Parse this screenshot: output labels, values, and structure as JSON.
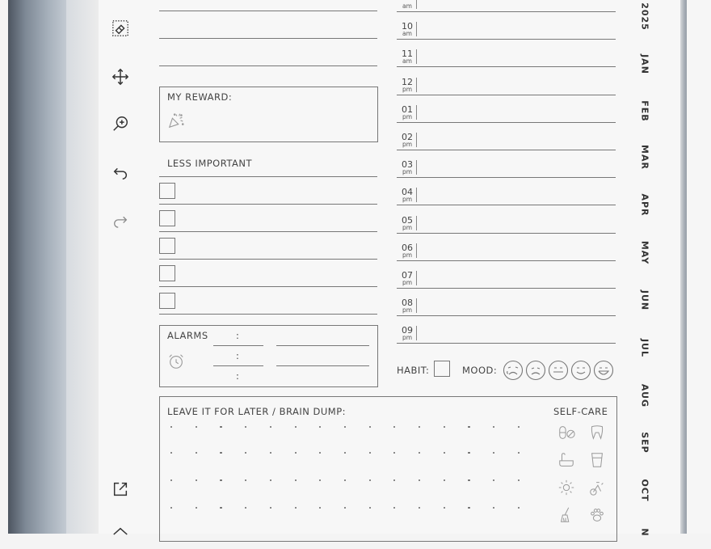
{
  "toolbar": {
    "icons": [
      "eraser-icon",
      "move-icon",
      "zoom-icon",
      "undo-icon",
      "redo-icon",
      "share-icon",
      "home-icon"
    ]
  },
  "planner": {
    "reward_label": "MY REWARD:",
    "less_important_label": "LESS IMPORTANT",
    "alarms_label": "ALARMS",
    "alarm_colon": ":",
    "brain_dump_label": "LEAVE IT FOR LATER / BRAIN DUMP:",
    "self_care_label": "SELF-CARE",
    "habit_label": "HABIT:",
    "mood_label": "MOOD:",
    "hours": [
      {
        "num": "",
        "ampm": "am"
      },
      {
        "num": "10",
        "ampm": "am"
      },
      {
        "num": "11",
        "ampm": "am"
      },
      {
        "num": "12",
        "ampm": "pm"
      },
      {
        "num": "01",
        "ampm": "pm"
      },
      {
        "num": "02",
        "ampm": "pm"
      },
      {
        "num": "03",
        "ampm": "pm"
      },
      {
        "num": "04",
        "ampm": "pm"
      },
      {
        "num": "05",
        "ampm": "pm"
      },
      {
        "num": "06",
        "ampm": "pm"
      },
      {
        "num": "07",
        "ampm": "pm"
      },
      {
        "num": "08",
        "ampm": "pm"
      },
      {
        "num": "09",
        "ampm": "pm"
      }
    ]
  },
  "months_tabs": {
    "year": "2025",
    "months": [
      "JAN",
      "FEB",
      "MAR",
      "APR",
      "MAY",
      "JUN",
      "JUL",
      "AUG",
      "SEP",
      "OCT",
      "N"
    ]
  }
}
